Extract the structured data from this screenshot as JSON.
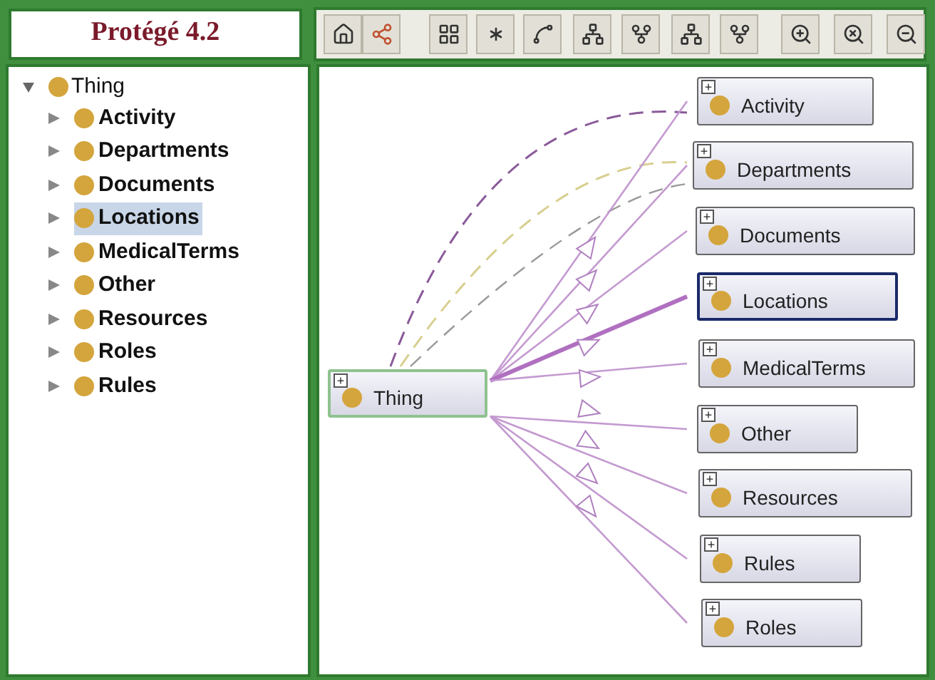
{
  "title": "Protégé 4.2",
  "tree": {
    "label": "Thing",
    "expanded": true,
    "children": [
      {
        "label": "Activity",
        "selected": false
      },
      {
        "label": "Departments",
        "selected": false
      },
      {
        "label": "Documents",
        "selected": false
      },
      {
        "label": "Locations",
        "selected": true
      },
      {
        "label": "MedicalTerms",
        "selected": false
      },
      {
        "label": "Other",
        "selected": false
      },
      {
        "label": "Resources",
        "selected": false
      },
      {
        "label": "Roles",
        "selected": false
      },
      {
        "label": "Rules",
        "selected": false
      }
    ]
  },
  "graph": {
    "root": {
      "label": "Thing",
      "expand": "+"
    },
    "nodes": [
      {
        "label": "Activity",
        "expand": "+",
        "selected": false
      },
      {
        "label": "Departments",
        "expand": "+",
        "selected": false
      },
      {
        "label": "Documents",
        "expand": "+",
        "selected": false
      },
      {
        "label": "Locations",
        "expand": "+",
        "selected": true
      },
      {
        "label": "MedicalTerms",
        "expand": "+",
        "selected": false
      },
      {
        "label": "Other",
        "expand": "+",
        "selected": false
      },
      {
        "label": "Resources",
        "expand": "+",
        "selected": false
      },
      {
        "label": "Rules",
        "expand": "+",
        "selected": false
      },
      {
        "label": "Roles",
        "expand": "+",
        "selected": false
      }
    ]
  }
}
